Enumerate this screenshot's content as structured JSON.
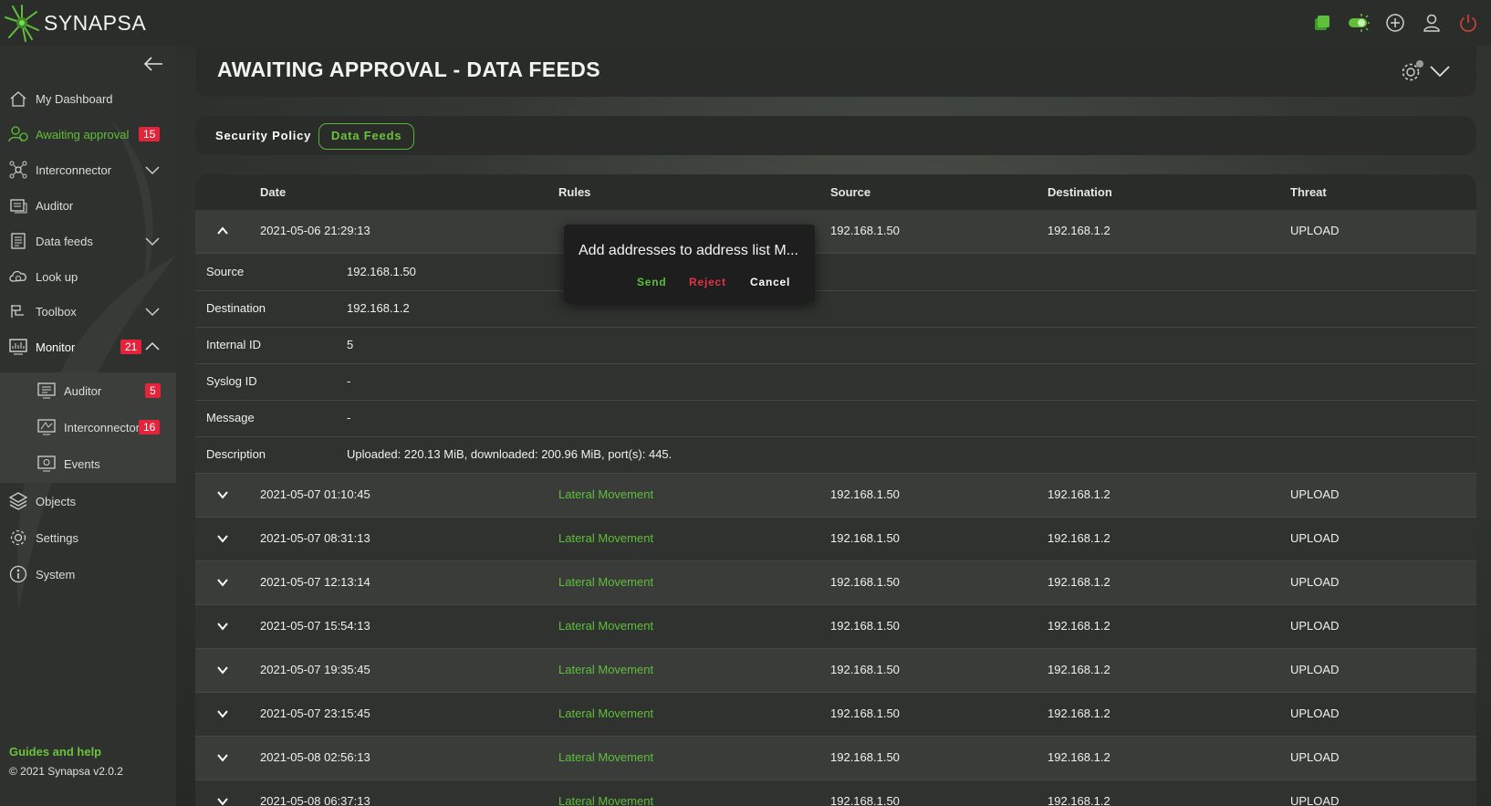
{
  "app": {
    "name": "SYNAPSA"
  },
  "colors": {
    "accent": "#5fbf3a",
    "badge": "#e3243b",
    "danger": "#e3334a"
  },
  "topbar": {
    "icons": [
      "notifications-icon",
      "theme-toggle-icon",
      "add-icon",
      "user-icon",
      "power-icon"
    ]
  },
  "sidebar": {
    "items": [
      {
        "label": "My Dashboard",
        "icon": "home-icon"
      },
      {
        "label": "Awaiting approval",
        "icon": "approval-icon",
        "badge": "15",
        "active": true
      },
      {
        "label": "Interconnector",
        "icon": "network-icon"
      },
      {
        "label": "Auditor",
        "icon": "auditor-icon"
      },
      {
        "label": "Data feeds",
        "icon": "data-feeds-icon"
      },
      {
        "label": "Look up",
        "icon": "cloud-lookup-icon"
      },
      {
        "label": "Toolbox",
        "icon": "toolbox-icon"
      },
      {
        "label": "Monitor",
        "icon": "monitor-icon",
        "badge": "21"
      }
    ],
    "monitor_sub": [
      {
        "label": "Auditor",
        "badge": "5"
      },
      {
        "label": "Interconnector",
        "badge": "16"
      },
      {
        "label": "Events"
      }
    ],
    "bottom_items": [
      {
        "label": "Objects",
        "icon": "layers-icon"
      },
      {
        "label": "Settings",
        "icon": "gear-icon"
      },
      {
        "label": "System",
        "icon": "system-icon"
      }
    ],
    "guides": "Guides and help",
    "copyright": "© 2021 Synapsa v2.0.2"
  },
  "page": {
    "title": "AWAITING APPROVAL - DATA FEEDS"
  },
  "tabs": [
    {
      "label": "Security Policy"
    },
    {
      "label": "Data Feeds",
      "active": true
    }
  ],
  "table": {
    "headers": [
      "Date",
      "Rules",
      "Source",
      "Destination",
      "Threat"
    ],
    "expanded": {
      "date": "2021-05-06 21:29:13",
      "source": "192.168.1.50",
      "destination": "192.168.1.2",
      "threat": "UPLOAD",
      "details": [
        {
          "label": "Source",
          "value": "192.168.1.50"
        },
        {
          "label": "Destination",
          "value": "192.168.1.2"
        },
        {
          "label": "Internal ID",
          "value": "5"
        },
        {
          "label": "Syslog ID",
          "value": "-"
        },
        {
          "label": "Message",
          "value": "-"
        },
        {
          "label": "Description",
          "value": "Uploaded: 220.13 MiB, downloaded: 200.96 MiB, port(s): 445."
        }
      ]
    },
    "rows": [
      {
        "date": "2021-05-07 01:10:45",
        "rule": "Lateral Movement",
        "source": "192.168.1.50",
        "destination": "192.168.1.2",
        "threat": "UPLOAD"
      },
      {
        "date": "2021-05-07 08:31:13",
        "rule": "Lateral Movement",
        "source": "192.168.1.50",
        "destination": "192.168.1.2",
        "threat": "UPLOAD"
      },
      {
        "date": "2021-05-07 12:13:14",
        "rule": "Lateral Movement",
        "source": "192.168.1.50",
        "destination": "192.168.1.2",
        "threat": "UPLOAD"
      },
      {
        "date": "2021-05-07 15:54:13",
        "rule": "Lateral Movement",
        "source": "192.168.1.50",
        "destination": "192.168.1.2",
        "threat": "UPLOAD"
      },
      {
        "date": "2021-05-07 19:35:45",
        "rule": "Lateral Movement",
        "source": "192.168.1.50",
        "destination": "192.168.1.2",
        "threat": "UPLOAD"
      },
      {
        "date": "2021-05-07 23:15:45",
        "rule": "Lateral Movement",
        "source": "192.168.1.50",
        "destination": "192.168.1.2",
        "threat": "UPLOAD"
      },
      {
        "date": "2021-05-08 02:56:13",
        "rule": "Lateral Movement",
        "source": "192.168.1.50",
        "destination": "192.168.1.2",
        "threat": "UPLOAD"
      },
      {
        "date": "2021-05-08 06:37:13",
        "rule": "Lateral Movement",
        "source": "192.168.1.50",
        "destination": "192.168.1.2",
        "threat": "UPLOAD"
      }
    ]
  },
  "popup": {
    "message": "Add addresses to address list M...",
    "send": "Send",
    "reject": "Reject",
    "cancel": "Cancel"
  }
}
